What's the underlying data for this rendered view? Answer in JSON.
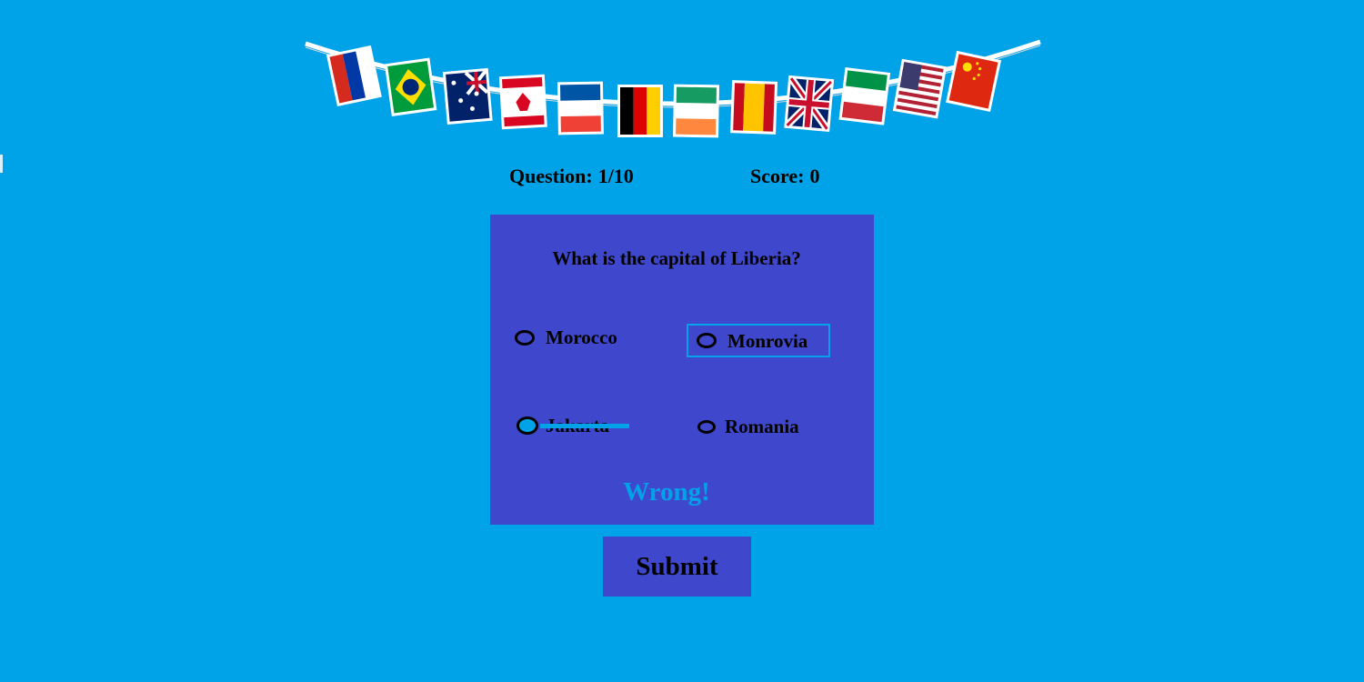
{
  "bunting": {
    "flags": [
      "russia-flag-icon",
      "brazil-flag-icon",
      "australia-flag-icon",
      "canada-flag-icon",
      "france-flag-icon",
      "germany-flag-icon",
      "ireland-flag-icon",
      "spain-flag-icon",
      "united-kingdom-flag-icon",
      "italy-flag-icon",
      "usa-flag-icon",
      "china-flag-icon"
    ]
  },
  "status": {
    "question_label": "Question:",
    "question_value": "1/10",
    "score_label": "Score:",
    "score_value": "0"
  },
  "quiz": {
    "question": "What is the capital of Liberia?",
    "options": [
      {
        "label": "Morocco"
      },
      {
        "label": "Monrovia"
      },
      {
        "label": "Jakarta"
      },
      {
        "label": "Romania"
      }
    ],
    "feedback": "Wrong!"
  },
  "submit": {
    "label": "Submit"
  },
  "colors": {
    "background": "#00a2e8",
    "panel": "#3f48cc",
    "accent": "#00a2e8",
    "text": "#000000"
  }
}
